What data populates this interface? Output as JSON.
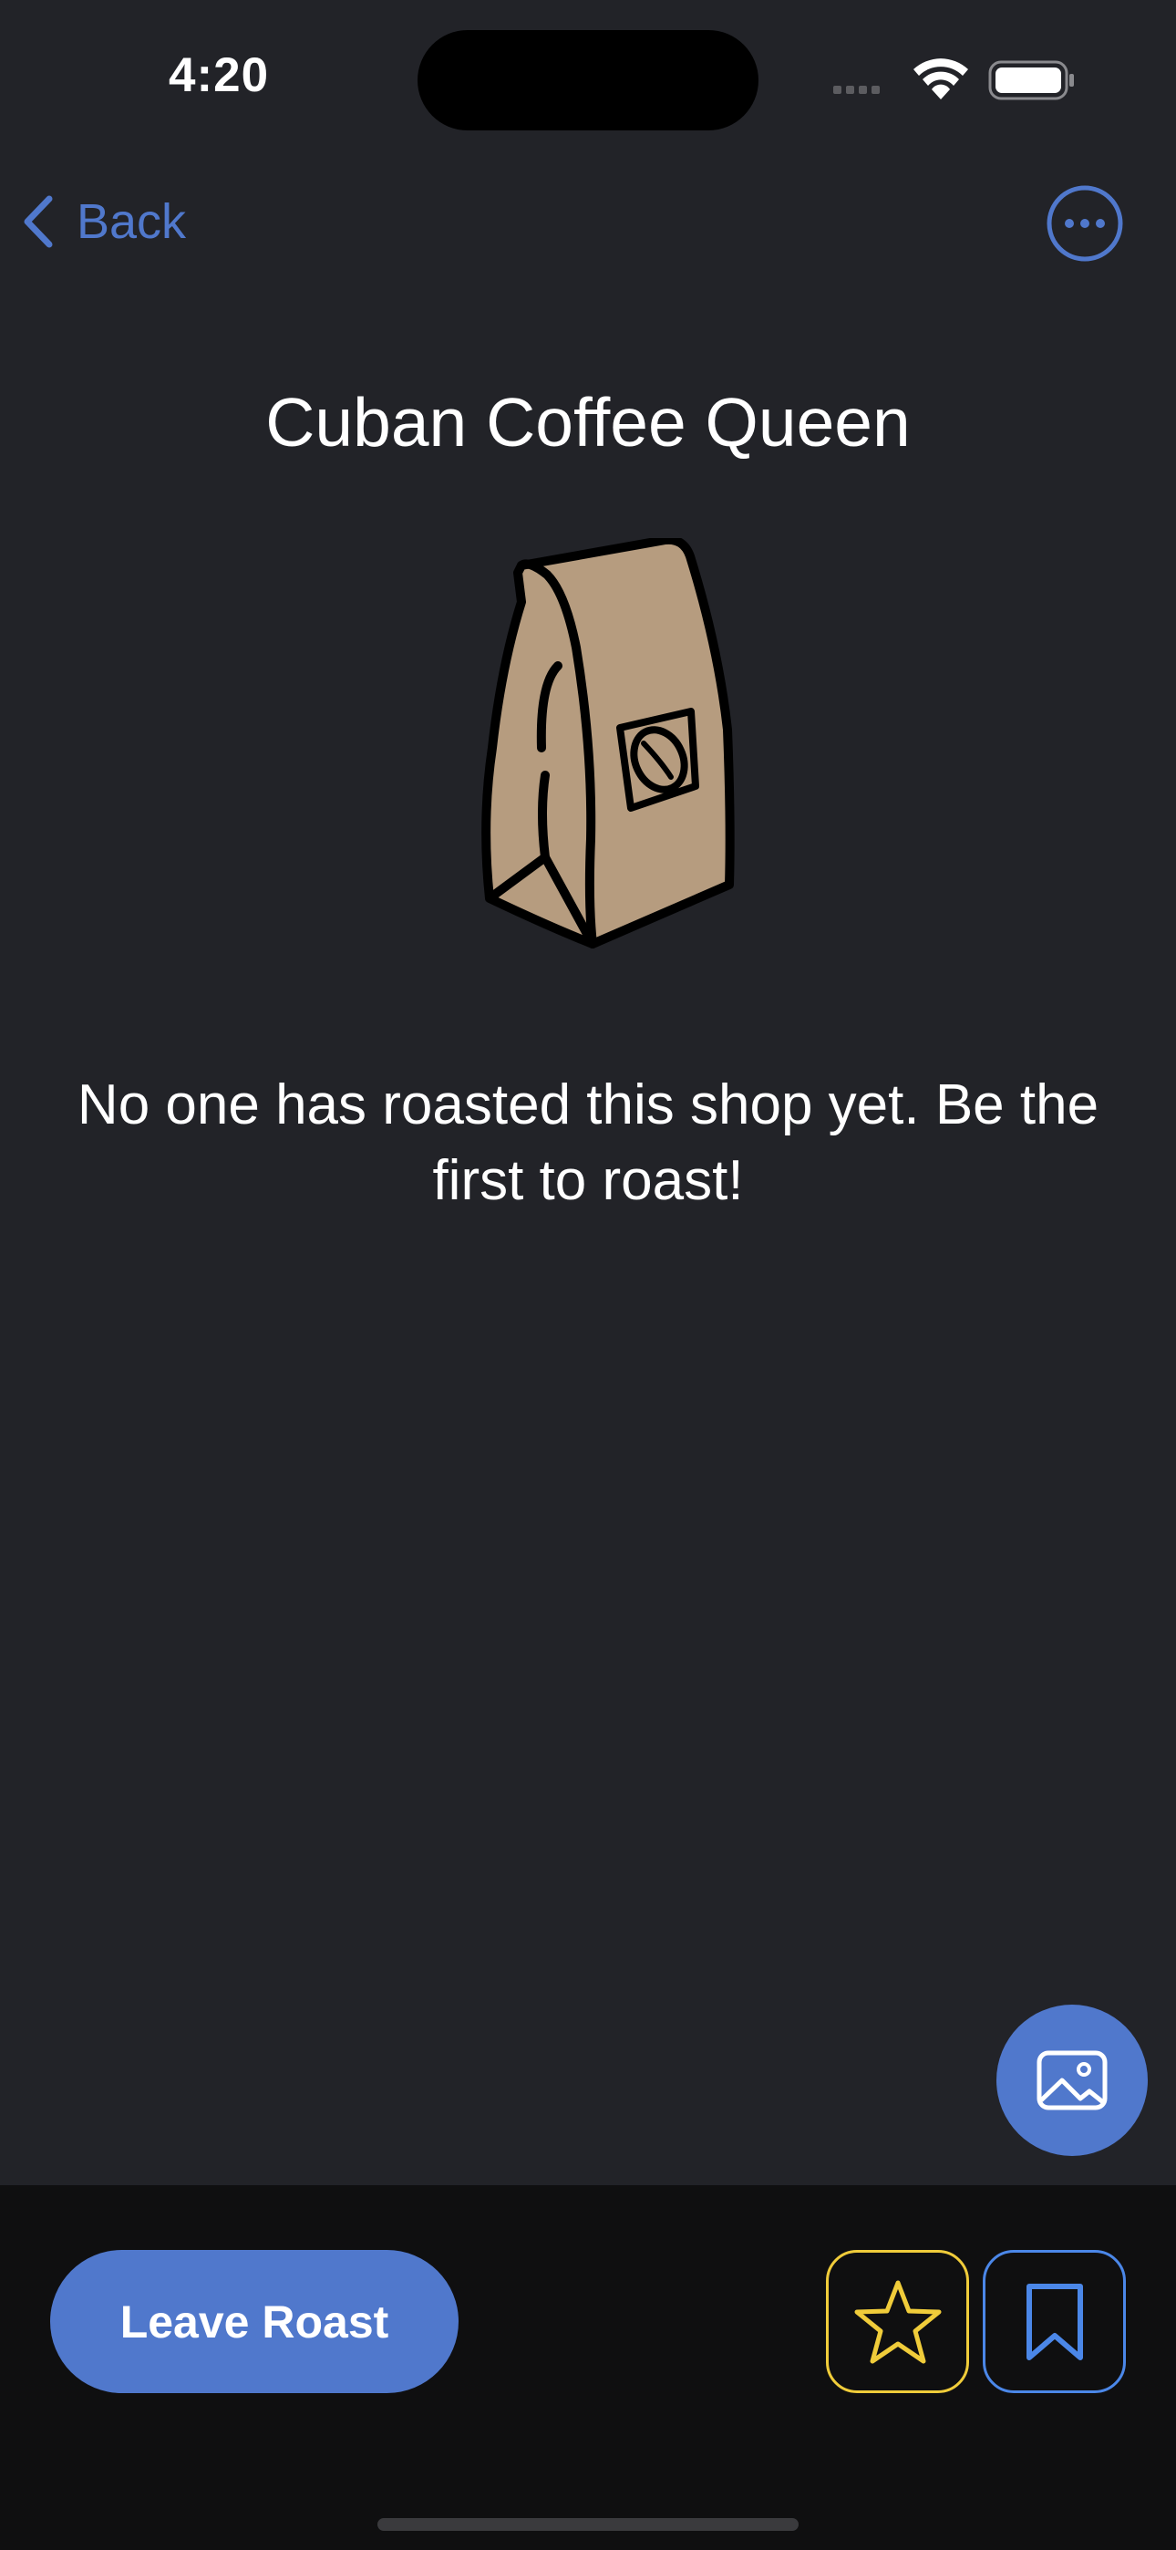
{
  "status_bar": {
    "time": "4:20"
  },
  "nav": {
    "back_label": "Back",
    "more_icon": "ellipsis-circle-icon"
  },
  "shop": {
    "name": "Cuban Coffee Queen"
  },
  "empty_state": {
    "illustration": "coffee-bag-icon",
    "message": "No one has roasted this shop yet. Be the first to roast!"
  },
  "actions": {
    "photo_icon": "photo-icon",
    "leave_roast_label": "Leave Roast",
    "favorite_icon": "star-icon",
    "bookmark_icon": "bookmark-icon"
  },
  "colors": {
    "background": "#222328",
    "bottom_bar": "#0f0f10",
    "accent_blue": "#5078cc",
    "star_yellow": "#f0cc3a",
    "bookmark_blue": "#4b87e8",
    "bag_fill": "#b69c7f"
  }
}
